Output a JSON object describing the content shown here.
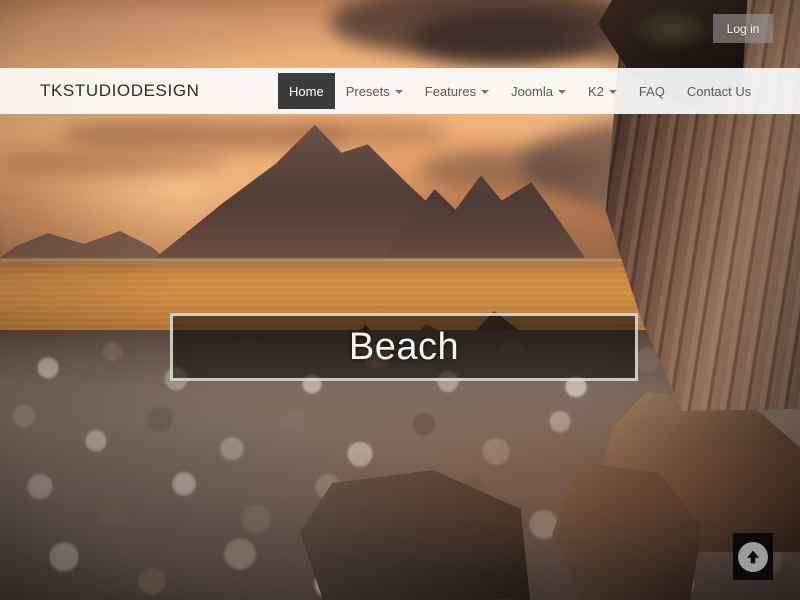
{
  "site": {
    "brand": "TKSTUDIODESIGN"
  },
  "topbar": {
    "login_label": "Log in"
  },
  "nav": {
    "items": [
      {
        "label": "Home",
        "has_dropdown": false,
        "active": true
      },
      {
        "label": "Presets",
        "has_dropdown": true,
        "active": false
      },
      {
        "label": "Features",
        "has_dropdown": true,
        "active": false
      },
      {
        "label": "Joomla",
        "has_dropdown": true,
        "active": false
      },
      {
        "label": "K2",
        "has_dropdown": true,
        "active": false
      },
      {
        "label": "FAQ",
        "has_dropdown": false,
        "active": false
      },
      {
        "label": "Contact Us",
        "has_dropdown": false,
        "active": false
      }
    ]
  },
  "hero": {
    "title": "Beach",
    "scene_description": "Sunset over a pebble beach with mountains, sea and a rocky cliff"
  },
  "scroll_top": {
    "icon": "arrow-up-icon",
    "label": "Back to top"
  },
  "colors": {
    "navbar_background": "#fafafa",
    "active_item_background": "#3b3b3b",
    "active_item_text": "#ffffff",
    "nav_text": "#5a5a5a",
    "brand_text": "#2e2e2e",
    "login_background": "#969696",
    "title_box_border": "#f5f5f5",
    "title_text": "#f4f4f4",
    "scroll_top_background": "#0c0907",
    "scroll_top_circle": "#9b9b9b"
  }
}
